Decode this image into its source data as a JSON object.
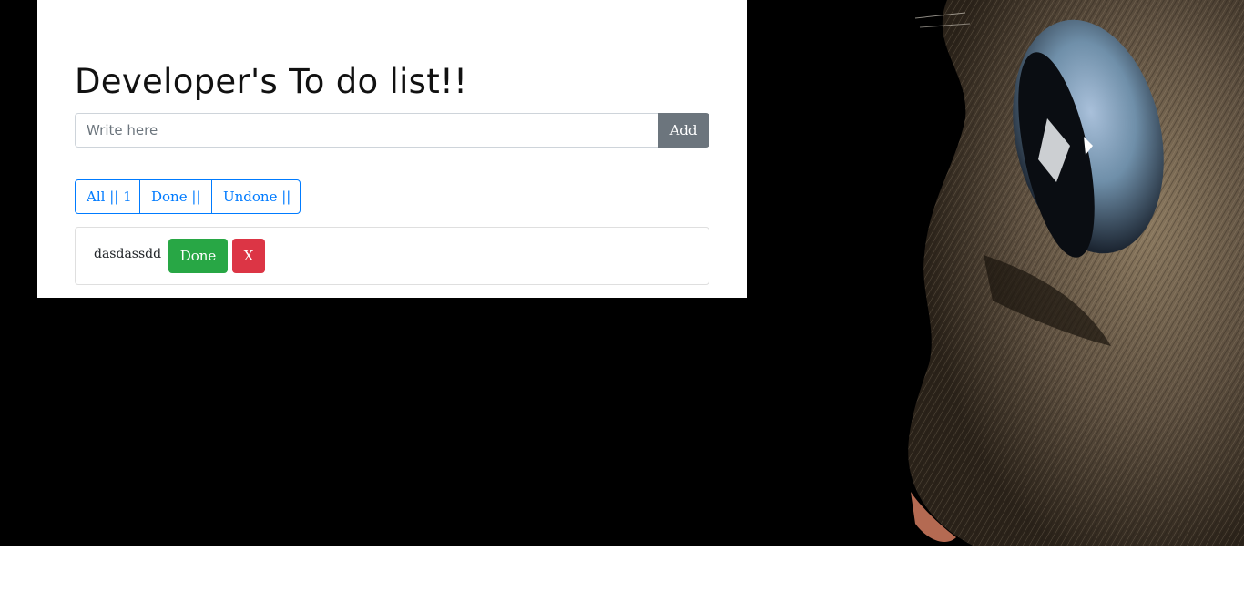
{
  "header": {
    "title": "Developer's To do list!!"
  },
  "new_task": {
    "placeholder": "Write here",
    "value": "",
    "add_label": "Add"
  },
  "filters": [
    {
      "label": "All || 1"
    },
    {
      "label": "Done ||"
    },
    {
      "label": "Undone ||"
    }
  ],
  "tasks": [
    {
      "text": "dasdassdd",
      "done_label": "Done",
      "delete_label": "X"
    }
  ],
  "background": {
    "subject": "cat-face-closeup",
    "colors": {
      "backdrop": "#000000",
      "fur": "#7a6a52",
      "eye": "#8fa7c4"
    }
  },
  "colors": {
    "primary": "#007bff",
    "success": "#28a745",
    "danger": "#dc3545",
    "secondary": "#6c757d"
  }
}
